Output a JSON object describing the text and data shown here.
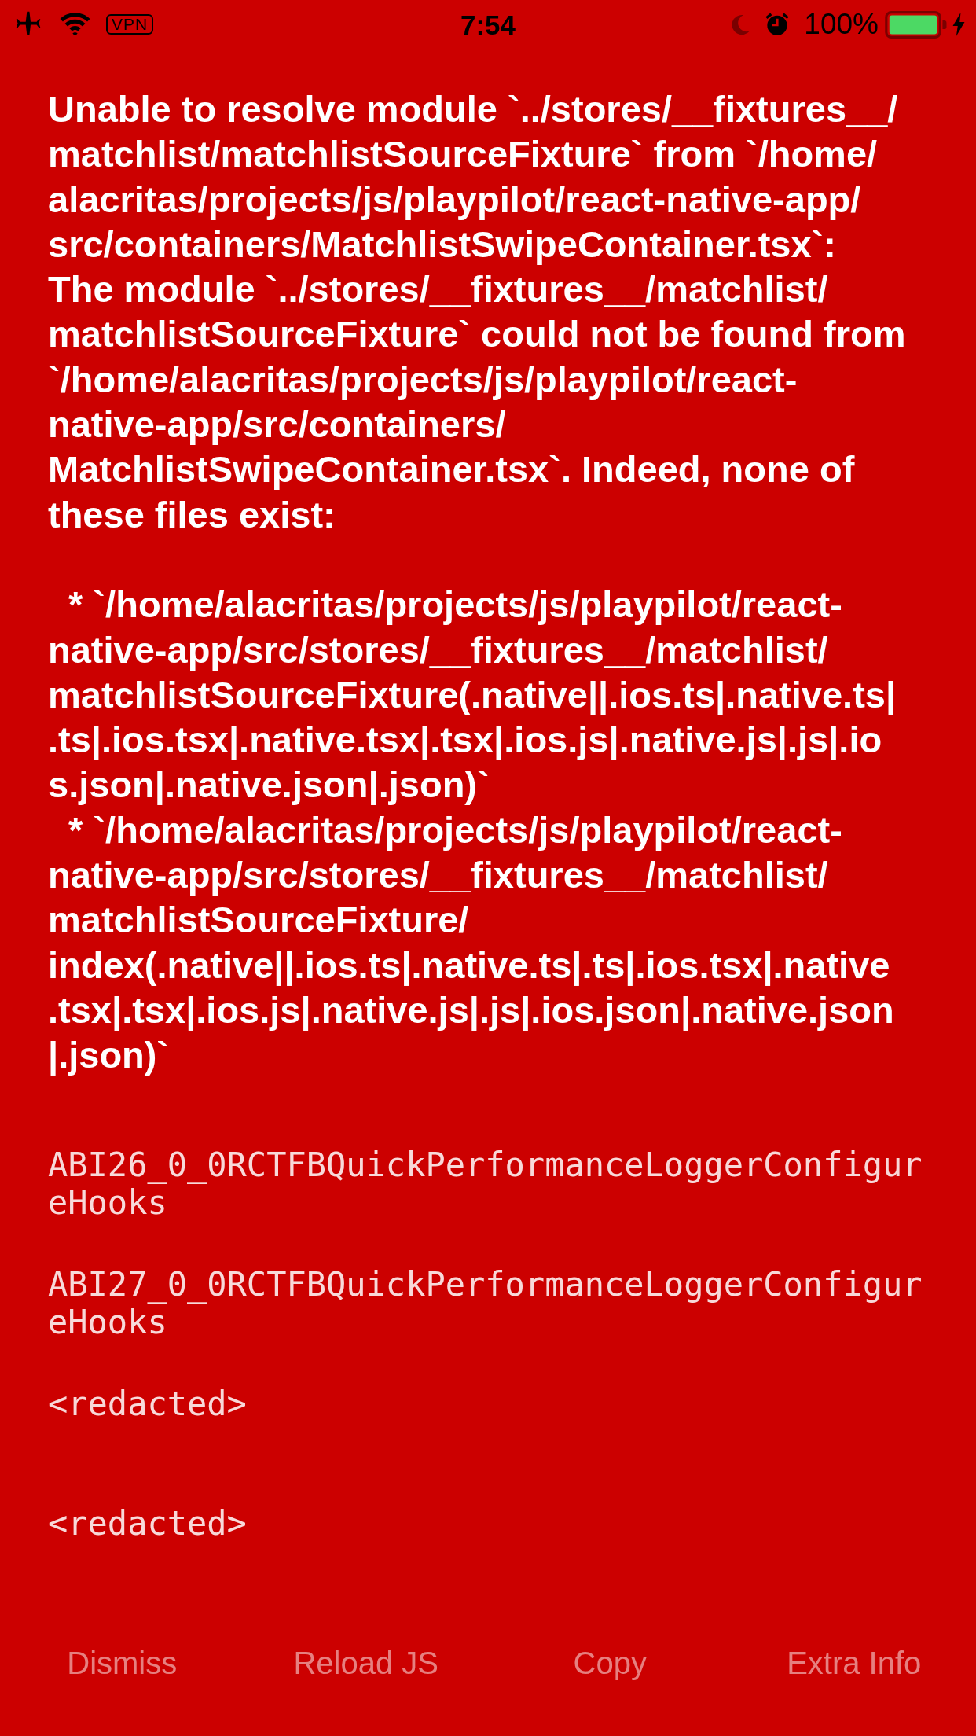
{
  "status_bar": {
    "vpn_badge": "VPN",
    "time": "7:54",
    "battery_percent": "100%"
  },
  "error": {
    "message_lines": [
      "Unable to resolve module `../stores/__fixtures__/",
      "matchlist/matchlistSourceFixture` from `/home/",
      "alacritas/projects/js/playpilot/react-native-app/",
      "src/containers/MatchlistSwipeContainer.tsx`:",
      "The module `../stores/__fixtures__/matchlist/",
      "matchlistSourceFixture` could not be found from",
      "`/home/alacritas/projects/js/playpilot/react-",
      "native-app/src/containers/",
      "MatchlistSwipeContainer.tsx`. Indeed, none of",
      "these files exist:"
    ],
    "missing_files": [
      {
        "lines": [
          "  * `/home/alacritas/projects/js/playpilot/react-",
          "native-app/src/stores/__fixtures__/matchlist/",
          "matchlistSourceFixture(.native||.ios.ts|.native.ts|",
          ".ts|.ios.tsx|.native.tsx|.tsx|.ios.js|.native.js|.js|.io",
          "s.json|.native.json|.json)`"
        ]
      },
      {
        "lines": [
          "  * `/home/alacritas/projects/js/playpilot/react-",
          "native-app/src/stores/__fixtures__/matchlist/",
          "matchlistSourceFixture/",
          "index(.native||.ios.ts|.native.ts|.ts|.ios.tsx|.native",
          ".tsx|.tsx|.ios.js|.native.js|.js|.ios.json|.native.json",
          "|.json)`"
        ]
      }
    ]
  },
  "stack_frames": [
    {
      "method": "ABI26_0_0RCTFBQuickPerformanceLoggerConfigureHooks"
    },
    {
      "method": "ABI27_0_0RCTFBQuickPerformanceLoggerConfigureHooks"
    },
    {
      "method": "<redacted>"
    },
    {
      "method": "<redacted>"
    }
  ],
  "buttons": [
    {
      "label": "Dismiss"
    },
    {
      "label": "Reload JS"
    },
    {
      "label": "Copy"
    },
    {
      "label": "Extra Info"
    }
  ]
}
